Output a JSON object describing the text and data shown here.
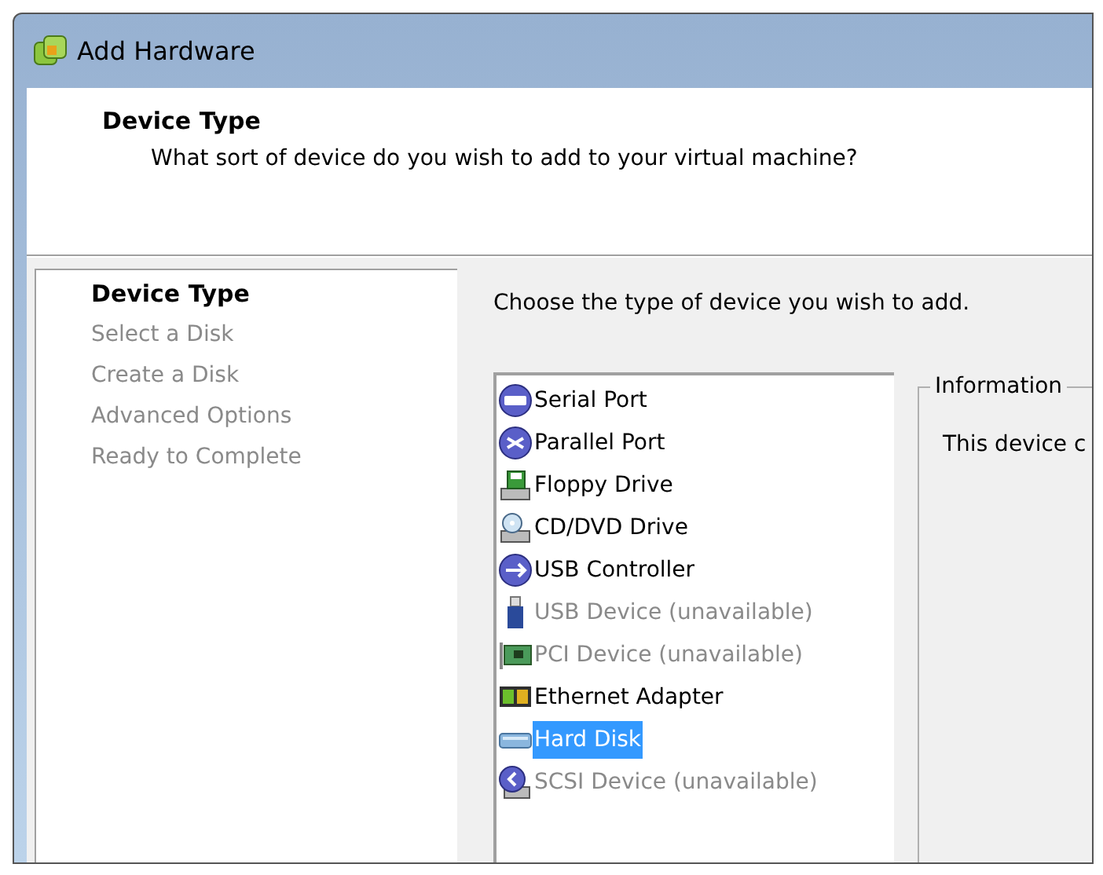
{
  "window": {
    "title": "Add Hardware"
  },
  "header": {
    "title": "Device Type",
    "subtitle": "What sort of device do you wish to add to your virtual machine?"
  },
  "steps": [
    {
      "label": "Device Type",
      "selected": true
    },
    {
      "label": "Select a Disk",
      "selected": false
    },
    {
      "label": "Create a Disk",
      "selected": false
    },
    {
      "label": "Advanced Options",
      "selected": false
    },
    {
      "label": "Ready to Complete",
      "selected": false
    }
  ],
  "prompt": "Choose the type of device you wish to add.",
  "devices": [
    {
      "label": "Serial Port",
      "kind": "serial",
      "disabled": false,
      "selected": false
    },
    {
      "label": "Parallel Port",
      "kind": "parallel",
      "disabled": false,
      "selected": false
    },
    {
      "label": "Floppy Drive",
      "kind": "floppy",
      "disabled": false,
      "selected": false
    },
    {
      "label": "CD/DVD Drive",
      "kind": "cd",
      "disabled": false,
      "selected": false
    },
    {
      "label": "USB Controller",
      "kind": "usbcontroller",
      "disabled": false,
      "selected": false
    },
    {
      "label": "USB Device (unavailable)",
      "kind": "usbdevice",
      "disabled": true,
      "selected": false
    },
    {
      "label": "PCI Device (unavailable)",
      "kind": "pci",
      "disabled": true,
      "selected": false
    },
    {
      "label": "Ethernet Adapter",
      "kind": "ethernet",
      "disabled": false,
      "selected": false
    },
    {
      "label": "Hard Disk",
      "kind": "disk",
      "disabled": false,
      "selected": true
    },
    {
      "label": "SCSI Device (unavailable)",
      "kind": "scsi",
      "disabled": true,
      "selected": false
    }
  ],
  "information": {
    "title": "Information",
    "text": "This device c"
  }
}
